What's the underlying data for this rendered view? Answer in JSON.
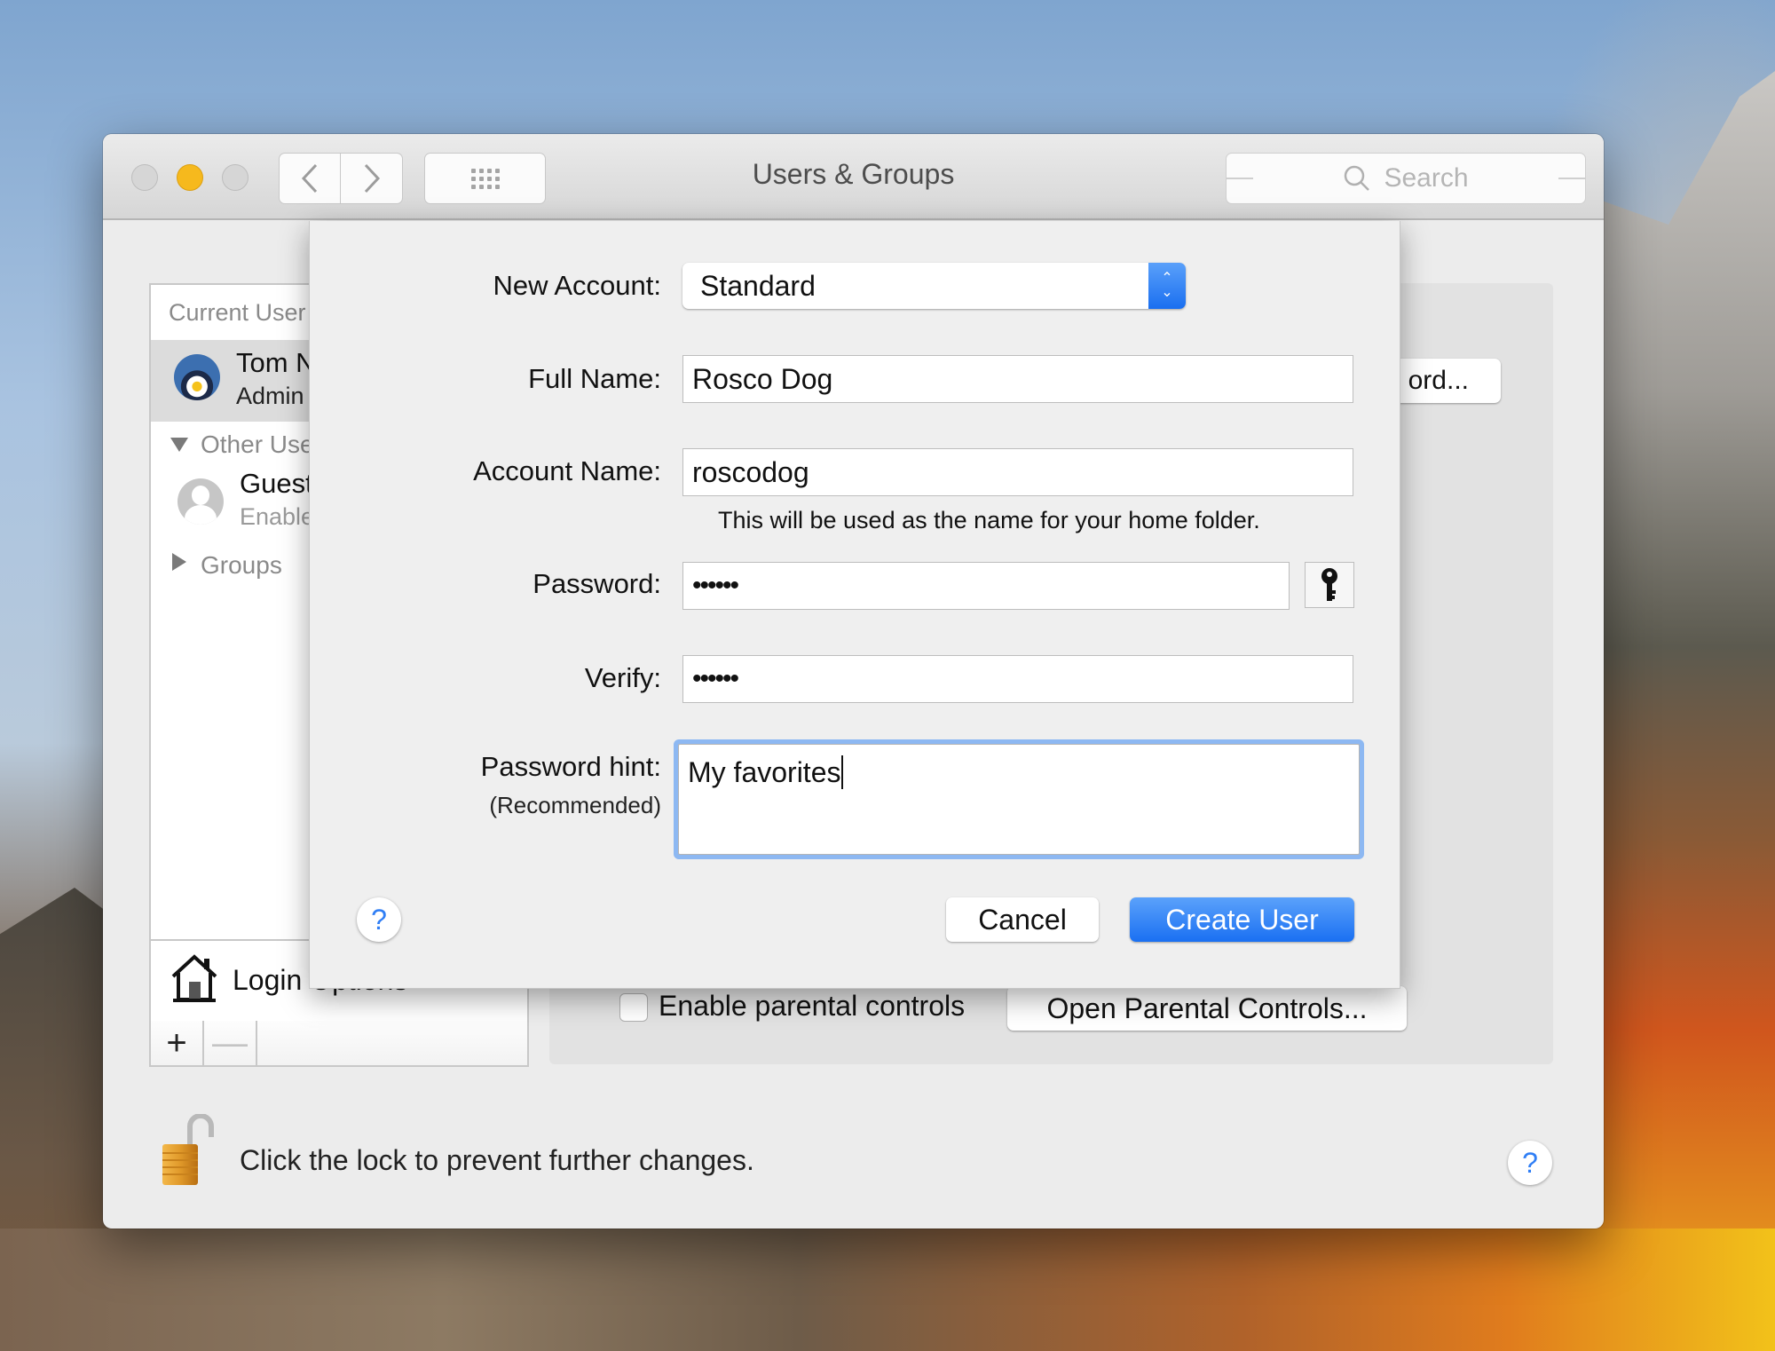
{
  "window": {
    "title": "Users & Groups",
    "search_placeholder": "Search"
  },
  "sidebar": {
    "current_users_header": "Current User",
    "current_user": {
      "name": "Tom N",
      "role": "Admin"
    },
    "other_users_header": "Other Users",
    "guest_user": {
      "name": "Guest User",
      "status": "Enabled"
    },
    "groups_label": "Groups",
    "login_options_label": "Login Options",
    "add_label": "+",
    "remove_label": "—"
  },
  "panel": {
    "change_password_button_visible": "ord...",
    "enable_parental_controls_label": "Enable parental controls",
    "enable_parental_controls_checked": false,
    "open_parental_controls_label": "Open Parental Controls..."
  },
  "footer": {
    "lock_text": "Click the lock to prevent further changes.",
    "help_label": "?"
  },
  "sheet": {
    "new_account_label": "New Account:",
    "new_account_value": "Standard",
    "full_name_label": "Full Name:",
    "full_name_value": "Rosco Dog",
    "account_name_label": "Account Name:",
    "account_name_value": "roscodog",
    "account_name_note": "This will be used as the name for your home folder.",
    "password_label": "Password:",
    "password_value": "••••••",
    "verify_label": "Verify:",
    "verify_value": "••••••",
    "hint_label": "Password hint:",
    "hint_sublabel": "(Recommended)",
    "hint_value": "My favorites",
    "help_label": "?",
    "cancel_label": "Cancel",
    "create_label": "Create User"
  },
  "colors": {
    "accent": "#1a70f2",
    "focus_ring": "#8db8f2",
    "minimize_light": "#f6b91d",
    "lock_gold": "#e0992a"
  }
}
